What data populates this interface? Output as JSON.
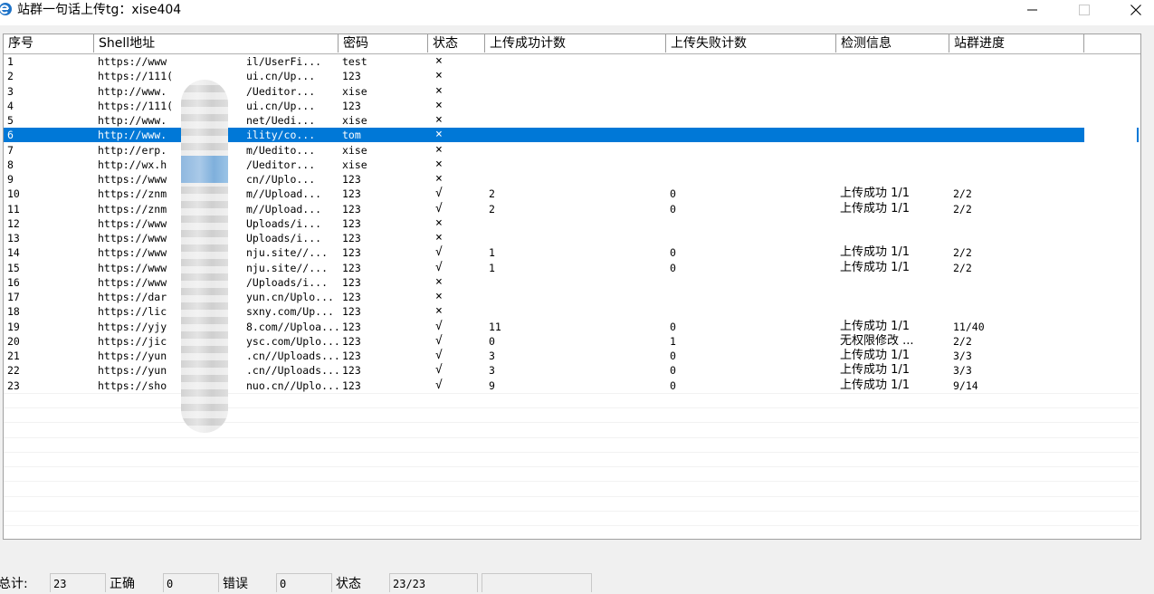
{
  "window": {
    "title": "站群一句话上传tg：xise404",
    "icon": "app-e-icon"
  },
  "columns": [
    "序号",
    "Shell地址",
    "密码",
    "状态",
    "上传成功计数",
    "上传失败计数",
    "检测信息",
    "站群进度"
  ],
  "rows": [
    {
      "no": "1",
      "url": "https://www",
      "url_end": "il/UserFi...",
      "pwd": "test",
      "status": "×",
      "ok": "",
      "fail": "",
      "info": "",
      "progress": ""
    },
    {
      "no": "2",
      "url": "https://111(",
      "url_end": "ui.cn/Up...",
      "pwd": "123",
      "status": "×",
      "ok": "",
      "fail": "",
      "info": "",
      "progress": ""
    },
    {
      "no": "3",
      "url": "http://www.",
      "url_end": "/Ueditor...",
      "pwd": "xise",
      "status": "×",
      "ok": "",
      "fail": "",
      "info": "",
      "progress": ""
    },
    {
      "no": "4",
      "url": "https://111(",
      "url_end": "ui.cn/Up...",
      "pwd": "123",
      "status": "×",
      "ok": "",
      "fail": "",
      "info": "",
      "progress": ""
    },
    {
      "no": "5",
      "url": "http://www.",
      "url_end": "net/Uedi...",
      "pwd": "xise",
      "status": "×",
      "ok": "",
      "fail": "",
      "info": "",
      "progress": ""
    },
    {
      "no": "6",
      "url": "http://www.",
      "url_end": "ility/co...",
      "pwd": "tom",
      "status": "×",
      "ok": "",
      "fail": "",
      "info": "",
      "progress": ""
    },
    {
      "no": "7",
      "url": "http://erp.",
      "url_end": "m/Uedito...",
      "pwd": "xise",
      "status": "×",
      "ok": "",
      "fail": "",
      "info": "",
      "progress": ""
    },
    {
      "no": "8",
      "url": "http://wx.h",
      "url_end": "/Ueditor...",
      "pwd": "xise",
      "status": "×",
      "ok": "",
      "fail": "",
      "info": "",
      "progress": ""
    },
    {
      "no": "9",
      "url": "https://www",
      "url_end": "cn//Uplo...",
      "pwd": "123",
      "status": "×",
      "ok": "",
      "fail": "",
      "info": "",
      "progress": ""
    },
    {
      "no": "10",
      "url": "https://znm",
      "url_end": "m//Upload...",
      "pwd": "123",
      "status": "√",
      "ok": "2",
      "fail": "0",
      "info": "上传成功  1/1",
      "progress": "2/2"
    },
    {
      "no": "11",
      "url": "https://znm",
      "url_end": "m//Upload...",
      "pwd": "123",
      "status": "√",
      "ok": "2",
      "fail": "0",
      "info": "上传成功  1/1",
      "progress": "2/2"
    },
    {
      "no": "12",
      "url": "https://www",
      "url_end": "Uploads/i...",
      "pwd": "123",
      "status": "×",
      "ok": "",
      "fail": "",
      "info": "",
      "progress": ""
    },
    {
      "no": "13",
      "url": "https://www",
      "url_end": "Uploads/i...",
      "pwd": "123",
      "status": "×",
      "ok": "",
      "fail": "",
      "info": "",
      "progress": ""
    },
    {
      "no": "14",
      "url": "https://www",
      "url_end": "nju.site//...",
      "pwd": "123",
      "status": "√",
      "ok": "1",
      "fail": "0",
      "info": "上传成功  1/1",
      "progress": "2/2"
    },
    {
      "no": "15",
      "url": "https://www",
      "url_end": "nju.site//...",
      "pwd": "123",
      "status": "√",
      "ok": "1",
      "fail": "0",
      "info": "上传成功  1/1",
      "progress": "2/2"
    },
    {
      "no": "16",
      "url": "https://www",
      "url_end": "/Uploads/i...",
      "pwd": "123",
      "status": "×",
      "ok": "",
      "fail": "",
      "info": "",
      "progress": ""
    },
    {
      "no": "17",
      "url": "https://dar",
      "url_end": "yun.cn/Uplo...",
      "pwd": "123",
      "status": "×",
      "ok": "",
      "fail": "",
      "info": "",
      "progress": ""
    },
    {
      "no": "18",
      "url": "https://lic",
      "url_end": "sxny.com/Up...",
      "pwd": "123",
      "status": "×",
      "ok": "",
      "fail": "",
      "info": "",
      "progress": ""
    },
    {
      "no": "19",
      "url": "https://yjy",
      "url_end": "8.com//Uploa...",
      "pwd": "123",
      "status": "√",
      "ok": "11",
      "fail": "0",
      "info": "上传成功  1/1",
      "progress": "11/40"
    },
    {
      "no": "20",
      "url": "https://jic",
      "url_end": "ysc.com/Uplo...",
      "pwd": "123",
      "status": "√",
      "ok": "0",
      "fail": "1",
      "info": "无权限修改 ...",
      "progress": "2/2"
    },
    {
      "no": "21",
      "url": "https://yun",
      "url_end": ".cn//Uploads...",
      "pwd": "123",
      "status": "√",
      "ok": "3",
      "fail": "0",
      "info": "上传成功  1/1",
      "progress": "3/3"
    },
    {
      "no": "22",
      "url": "https://yun",
      "url_end": ".cn//Uploads...",
      "pwd": "123",
      "status": "√",
      "ok": "3",
      "fail": "0",
      "info": "上传成功  1/1",
      "progress": "3/3"
    },
    {
      "no": "23",
      "url": "https://sho",
      "url_end": "nuo.cn//Uplo...",
      "pwd": "123",
      "status": "√",
      "ok": "9",
      "fail": "0",
      "info": "上传成功  1/1",
      "progress": "9/14"
    }
  ],
  "selected_row": "6",
  "status_bar": {
    "total_label": "总计:",
    "total_value": "23",
    "correct_label": "正确",
    "correct_value": "0",
    "error_label": "错误",
    "error_value": "0",
    "state_label": "状态",
    "state_value": "23/23",
    "extra_value": ""
  },
  "colors": {
    "selection": "#0078d7",
    "window_bg": "#f0f0f0",
    "list_bg": "#ffffff"
  }
}
